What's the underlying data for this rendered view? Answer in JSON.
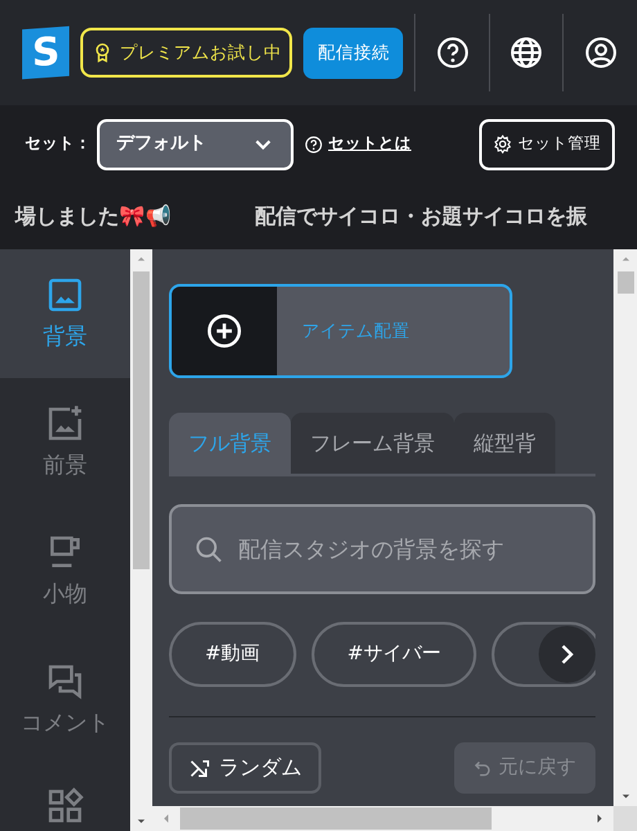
{
  "header": {
    "logo": "S",
    "premium_button": "プレミアムお試し中",
    "connect_button": "配信接続"
  },
  "set_bar": {
    "label": "セット：",
    "select_value": "デフォルト",
    "help_link": "セットとは",
    "manage_button": "セット管理"
  },
  "ticker": [
    "場しました🎀📢",
    "配信でサイコロ・お題サイコロを振"
  ],
  "sidebar": {
    "items": [
      {
        "label": "背景",
        "selected": true
      },
      {
        "label": "前景",
        "selected": false
      },
      {
        "label": "小物",
        "selected": false
      },
      {
        "label": "コメント",
        "selected": false
      },
      {
        "selected": false
      }
    ]
  },
  "panel": {
    "place_button": "アイテム配置",
    "tabs": [
      {
        "label": "フル背景",
        "selected": true
      },
      {
        "label": "フレーム背景",
        "selected": false
      },
      {
        "label": "縦型背",
        "selected": false
      }
    ],
    "search": {
      "placeholder": "配信スタジオの背景を探す"
    },
    "tags": [
      "#動画",
      "#サイバー"
    ],
    "random_button": "ランダム",
    "undo_button": {
      "label": "元に戻す",
      "disabled": true
    }
  }
}
